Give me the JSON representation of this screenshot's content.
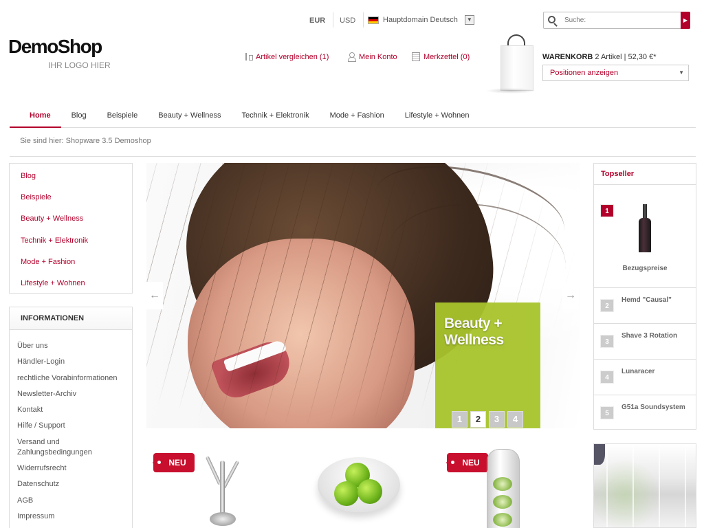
{
  "header": {
    "logo_main": "DemoShop",
    "logo_sub": "IHR LOGO HIER",
    "currency_eur": "EUR",
    "currency_usd": "USD",
    "language": "Hauptdomain Deutsch",
    "search_placeholder": "Suche:",
    "compare_link": "Artikel vergleichen (1)",
    "account_link": "Mein Konto",
    "wishlist_link": "Merkzettel (0)",
    "cart_title": "WARENKORB",
    "cart_summary": "2 Artikel  |  52,30 €*",
    "cart_positions": "Positionen anzeigen"
  },
  "nav": {
    "items": [
      "Home",
      "Blog",
      "Beispiele",
      "Beauty + Wellness",
      "Technik + Elektronik",
      "Mode + Fashion",
      "Lifestyle + Wohnen"
    ],
    "active": "Home"
  },
  "breadcrumb": "Sie sind hier: Shopware 3.5 Demoshop",
  "categories": [
    "Blog",
    "Beispiele",
    "Beauty + Wellness",
    "Technik + Elektronik",
    "Mode + Fashion",
    "Lifestyle + Wohnen"
  ],
  "info": {
    "title": "INFORMATIONEN",
    "links": [
      "Über uns",
      "Händler-Login",
      "rechtliche Vorabinformationen",
      "Newsletter-Archiv",
      "Kontakt",
      "Hilfe / Support",
      "Versand und Zahlungsbedingungen",
      "Widerrufsrecht",
      "Datenschutz",
      "AGB",
      "Impressum"
    ]
  },
  "slider": {
    "caption_line1": "Beauty +",
    "caption_line2": "Wellness",
    "pages": [
      "1",
      "2",
      "3",
      "4"
    ],
    "active_page": "2"
  },
  "topseller": {
    "title": "Topseller",
    "items": [
      {
        "rank": "1",
        "name": "Bezugspreise"
      },
      {
        "rank": "2",
        "name": "Hemd \"Causal\""
      },
      {
        "rank": "3",
        "name": "Shave 3 Rotation"
      },
      {
        "rank": "4",
        "name": "Lunaracer"
      },
      {
        "rank": "5",
        "name": "G51a Soundsystem"
      }
    ]
  },
  "products": {
    "new_badge": "NEU"
  },
  "colors": {
    "accent": "#b2002b",
    "badge_green": "#a8c42b"
  }
}
